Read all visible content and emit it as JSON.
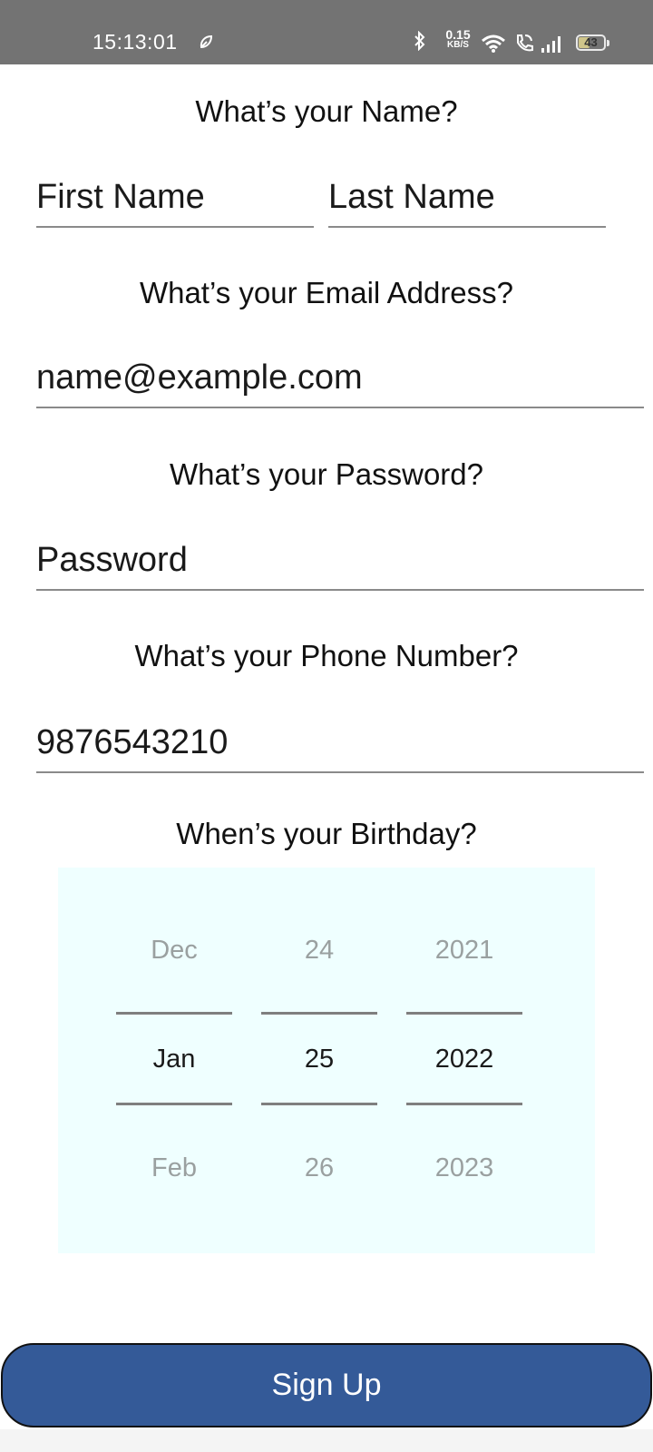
{
  "status_bar": {
    "time": "15:13:01",
    "net_speed_value": "0.15",
    "net_speed_unit": "KB/S",
    "battery": "43",
    "icons": [
      "leaf-icon",
      "bluetooth-icon",
      "wifi-icon",
      "wifi-calling-icon",
      "signal-icon",
      "battery-icon"
    ]
  },
  "name_section": {
    "question": "What’s your Name?",
    "first_name_placeholder": "First Name",
    "last_name_placeholder": "Last Name"
  },
  "email_section": {
    "question": "What’s your Email Address?",
    "placeholder": "name@example.com"
  },
  "password_section": {
    "question": "What’s your Password?",
    "placeholder": "Password"
  },
  "phone_section": {
    "question": "What’s your Phone Number?",
    "placeholder": "9876543210"
  },
  "birthday_section": {
    "question": "When’s your Birthday?",
    "month": {
      "prev": "Dec",
      "selected": "Jan",
      "next": "Feb"
    },
    "day": {
      "prev": "24",
      "selected": "25",
      "next": "26"
    },
    "year": {
      "prev": "2021",
      "selected": "2022",
      "next": "2023"
    }
  },
  "signup_button": {
    "label": "Sign Up"
  },
  "colors": {
    "status_bar": "#737373",
    "button": "#345a98",
    "picker_bg": "#efffff"
  }
}
